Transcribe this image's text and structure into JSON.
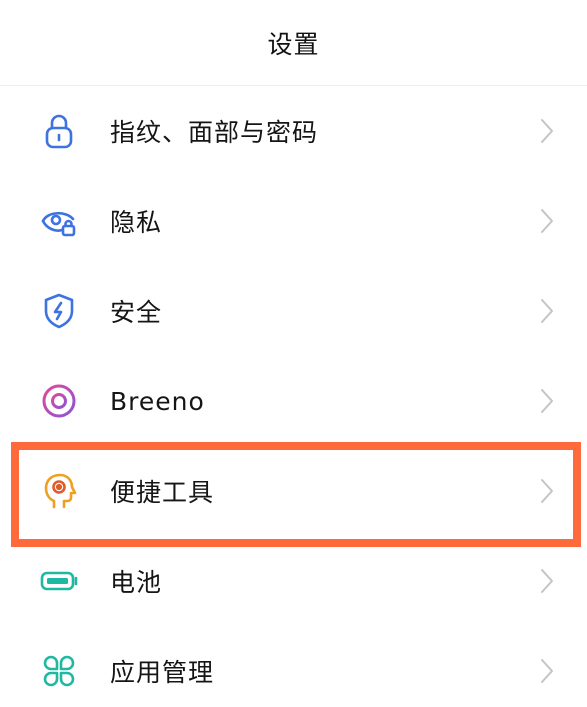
{
  "header": {
    "title": "设置"
  },
  "items": [
    {
      "label": "指纹、面部与密码",
      "icon": "lock-icon",
      "color": "#3d73e0"
    },
    {
      "label": "隐私",
      "icon": "eye-lock-icon",
      "color": "#3d73e0"
    },
    {
      "label": "安全",
      "icon": "shield-bolt-icon",
      "color": "#3d73e0"
    },
    {
      "label": "Breeno",
      "icon": "breeno-ring-icon",
      "color": "#c04ac7"
    },
    {
      "label": "便捷工具",
      "icon": "head-target-icon",
      "color": "#f0a020"
    },
    {
      "label": "电池",
      "icon": "battery-icon",
      "color": "#1fb8a0"
    },
    {
      "label": "应用管理",
      "icon": "app-grid-icon",
      "color": "#1fb8a0"
    }
  ],
  "highlight_color": "#ff6a3c",
  "chevron_icon": "chevron-right-icon"
}
